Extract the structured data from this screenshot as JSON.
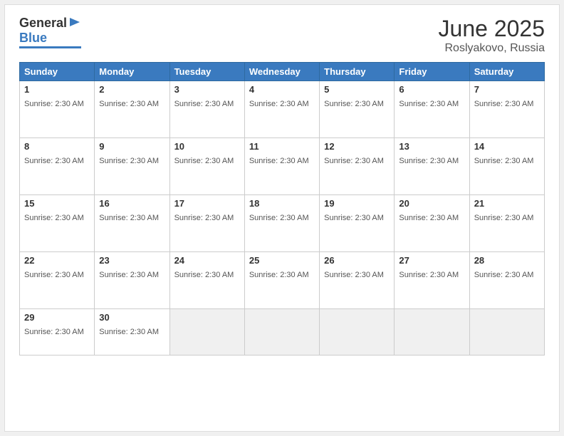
{
  "logo": {
    "general": "General",
    "blue": "Blue"
  },
  "header": {
    "month": "June 2025",
    "location": "Roslyakovo, Russia"
  },
  "days_of_week": [
    "Sunday",
    "Monday",
    "Tuesday",
    "Wednesday",
    "Thursday",
    "Friday",
    "Saturday"
  ],
  "sunrise": "Sunrise: 2:30 AM",
  "weeks": [
    [
      {
        "day": "1",
        "sunrise": "Sunrise: 2:30 AM"
      },
      {
        "day": "2",
        "sunrise": "Sunrise: 2:30 AM"
      },
      {
        "day": "3",
        "sunrise": "Sunrise: 2:30 AM"
      },
      {
        "day": "4",
        "sunrise": "Sunrise: 2:30 AM"
      },
      {
        "day": "5",
        "sunrise": "Sunrise: 2:30 AM"
      },
      {
        "day": "6",
        "sunrise": "Sunrise: 2:30 AM"
      },
      {
        "day": "7",
        "sunrise": "Sunrise: 2:30 AM"
      }
    ],
    [
      {
        "day": "8",
        "sunrise": "Sunrise: 2:30 AM"
      },
      {
        "day": "9",
        "sunrise": "Sunrise: 2:30 AM"
      },
      {
        "day": "10",
        "sunrise": "Sunrise: 2:30 AM"
      },
      {
        "day": "11",
        "sunrise": "Sunrise: 2:30 AM"
      },
      {
        "day": "12",
        "sunrise": "Sunrise: 2:30 AM"
      },
      {
        "day": "13",
        "sunrise": "Sunrise: 2:30 AM"
      },
      {
        "day": "14",
        "sunrise": "Sunrise: 2:30 AM"
      }
    ],
    [
      {
        "day": "15",
        "sunrise": "Sunrise: 2:30 AM"
      },
      {
        "day": "16",
        "sunrise": "Sunrise: 2:30 AM"
      },
      {
        "day": "17",
        "sunrise": "Sunrise: 2:30 AM"
      },
      {
        "day": "18",
        "sunrise": "Sunrise: 2:30 AM"
      },
      {
        "day": "19",
        "sunrise": "Sunrise: 2:30 AM"
      },
      {
        "day": "20",
        "sunrise": "Sunrise: 2:30 AM"
      },
      {
        "day": "21",
        "sunrise": "Sunrise: 2:30 AM"
      }
    ],
    [
      {
        "day": "22",
        "sunrise": "Sunrise: 2:30 AM"
      },
      {
        "day": "23",
        "sunrise": "Sunrise: 2:30 AM"
      },
      {
        "day": "24",
        "sunrise": "Sunrise: 2:30 AM"
      },
      {
        "day": "25",
        "sunrise": "Sunrise: 2:30 AM"
      },
      {
        "day": "26",
        "sunrise": "Sunrise: 2:30 AM"
      },
      {
        "day": "27",
        "sunrise": "Sunrise: 2:30 AM"
      },
      {
        "day": "28",
        "sunrise": "Sunrise: 2:30 AM"
      }
    ],
    [
      {
        "day": "29",
        "sunrise": "Sunrise: 2:30 AM"
      },
      {
        "day": "30",
        "sunrise": "Sunrise: 2:30 AM"
      },
      null,
      null,
      null,
      null,
      null
    ]
  ]
}
